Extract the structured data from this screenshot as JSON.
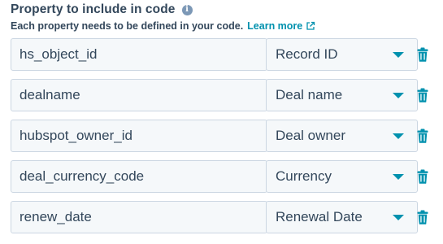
{
  "header": {
    "title": "Property to include in code",
    "info_icon": "info-icon",
    "subtitle": "Each property needs to be defined in your code.",
    "learn_more": "Learn more",
    "external_icon": "external-link-icon"
  },
  "colors": {
    "text": "#33475b",
    "link": "#0091ae",
    "input_bg": "#f5f8fa",
    "border": "#cbd6e2",
    "caret": "#0091ae",
    "trash": "#0091ae"
  },
  "rows": [
    {
      "property": "hs_object_id",
      "label": "Record ID"
    },
    {
      "property": "dealname",
      "label": "Deal name"
    },
    {
      "property": "hubspot_owner_id",
      "label": "Deal owner"
    },
    {
      "property": "deal_currency_code",
      "label": "Currency"
    },
    {
      "property": "renew_date",
      "label": "Renewal Date"
    }
  ]
}
